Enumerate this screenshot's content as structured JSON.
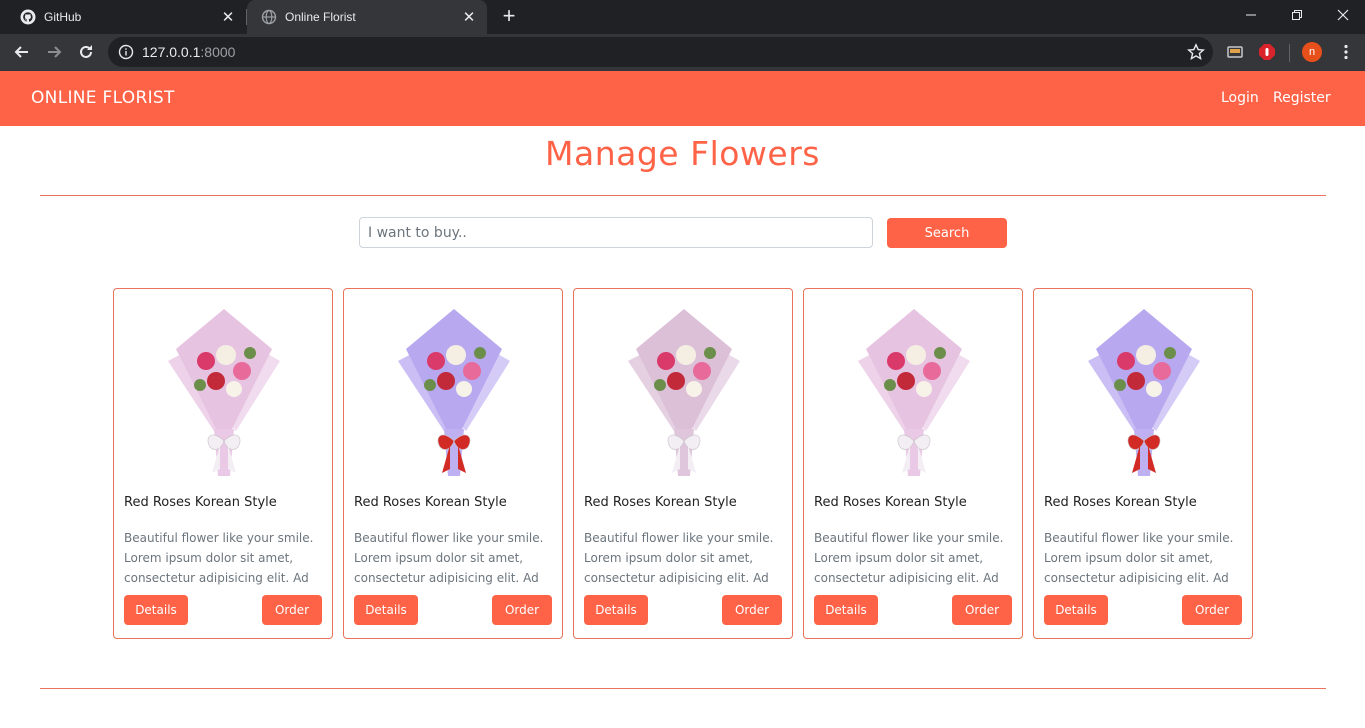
{
  "browser": {
    "tabs": [
      {
        "title": "GitHub",
        "active": false
      },
      {
        "title": "Online Florist",
        "active": true
      }
    ],
    "url_host": "127.0.0.1",
    "url_port": ":8000",
    "profile_initial": "n",
    "icons": [
      "github-icon",
      "globe-icon",
      "back-icon",
      "forward-icon",
      "reload-icon",
      "info-icon",
      "star-icon",
      "cast-icon",
      "adblock-icon",
      "menu-icon"
    ]
  },
  "nav": {
    "brand": "ONLINE FLORIST",
    "login": "Login",
    "register": "Register"
  },
  "page": {
    "title": "Manage Flowers"
  },
  "search": {
    "placeholder": "I want to buy..",
    "button": "Search"
  },
  "products": [
    {
      "name": "Red Roses Korean Style",
      "desc": "Beautiful flower like your smile. Lorem ipsum dolor sit amet, consectetur adipisicing elit. Ad",
      "details": "Details",
      "order": "Order",
      "wrap": "#e7c3e2",
      "ribbon": "#f3eef3"
    },
    {
      "name": "Red Roses Korean Style",
      "desc": "Beautiful flower like your smile. Lorem ipsum dolor sit amet, consectetur adipisicing elit. Ad",
      "details": "Details",
      "order": "Order",
      "wrap": "#b8a8f0",
      "ribbon": "#d22a25"
    },
    {
      "name": "Red Roses Korean Style",
      "desc": "Beautiful flower like your smile. Lorem ipsum dolor sit amet, consectetur adipisicing elit. Ad",
      "details": "Details",
      "order": "Order",
      "wrap": "#dcc0d8",
      "ribbon": "#f3eef3"
    },
    {
      "name": "Red Roses Korean Style",
      "desc": "Beautiful flower like your smile. Lorem ipsum dolor sit amet, consectetur adipisicing elit. Ad",
      "details": "Details",
      "order": "Order",
      "wrap": "#e7c3e2",
      "ribbon": "#f3eef3"
    },
    {
      "name": "Red Roses Korean Style",
      "desc": "Beautiful flower like your smile. Lorem ipsum dolor sit amet, consectetur adipisicing elit. Ad",
      "details": "Details",
      "order": "Order",
      "wrap": "#b8a8f0",
      "ribbon": "#d22a25"
    }
  ],
  "colors": {
    "accent": "#ff6347",
    "rule": "#e8735b"
  }
}
